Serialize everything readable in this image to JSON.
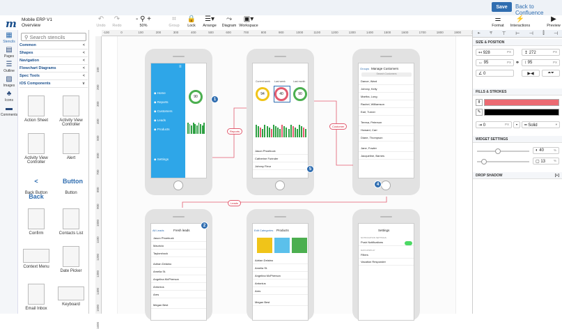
{
  "header": {
    "save_label": "Save",
    "back_label": "Back to Confluence",
    "app_title": "Mobile ERP V1",
    "page_name": "Overview",
    "logo": "m"
  },
  "toolbar": [
    {
      "name": "undo",
      "icon": "undo-icon",
      "glyph": "↶",
      "label": "Undo",
      "disabled": true
    },
    {
      "name": "redo",
      "icon": "redo-icon",
      "glyph": "↷",
      "label": "Redo",
      "disabled": true
    },
    {
      "name": "zoom",
      "icon": "zoom-icon",
      "glyph": "- ⚲ +",
      "label": "50%",
      "disabled": false
    },
    {
      "name": "group",
      "icon": "group-icon",
      "glyph": "⌗",
      "label": "Group",
      "disabled": true
    },
    {
      "name": "lock",
      "icon": "lock-icon",
      "glyph": "🔒",
      "label": "Lock",
      "disabled": false
    },
    {
      "name": "arrange",
      "icon": "arrange-icon",
      "glyph": "☰▾",
      "label": "Arrange",
      "disabled": false
    },
    {
      "name": "diagram",
      "icon": "diagram-icon",
      "glyph": "⤳",
      "label": "Diagram",
      "disabled": false
    },
    {
      "name": "workspace",
      "icon": "workspace-icon",
      "glyph": "▣▾",
      "label": "Workspace",
      "disabled": false
    }
  ],
  "right_toolbar": [
    {
      "name": "format",
      "icon": "format-icon",
      "glyph": "⚌",
      "label": "Format"
    },
    {
      "name": "interactions",
      "icon": "lightning-icon",
      "glyph": "⚡",
      "label": "Interactions"
    },
    {
      "name": "preview",
      "icon": "preview-icon",
      "glyph": "▶",
      "label": "Preview"
    }
  ],
  "leftnav": [
    {
      "name": "stencils",
      "icon": "stencils-icon",
      "glyph": "▦",
      "label": "Stencils",
      "active": true
    },
    {
      "name": "pages",
      "icon": "pages-icon",
      "glyph": "▤",
      "label": "Pages",
      "active": false
    },
    {
      "name": "outline",
      "icon": "outline-icon",
      "glyph": "☰",
      "label": "Outline",
      "active": false
    },
    {
      "name": "images",
      "icon": "images-icon",
      "glyph": "▨",
      "label": "Images",
      "active": false
    },
    {
      "name": "icons",
      "icon": "club-icon",
      "glyph": "♣",
      "label": "Icons",
      "active": false
    },
    {
      "name": "comments",
      "icon": "comments-icon",
      "glyph": "▬",
      "label": "Comments",
      "active": false
    }
  ],
  "stencil_search": "Search stencils",
  "categories": [
    {
      "label": "Common",
      "state": "<"
    },
    {
      "label": "Shapes",
      "state": "<"
    },
    {
      "label": "Navigation",
      "state": "<"
    },
    {
      "label": "Flowchart Diagrams",
      "state": "<"
    },
    {
      "label": "Spec Tools",
      "state": "<"
    },
    {
      "label": "iOS Components",
      "state": "∨"
    }
  ],
  "stencils": [
    {
      "label": "Action Sheet",
      "thumb": "normal"
    },
    {
      "label": "Activity View Controller",
      "thumb": "normal"
    },
    {
      "label": "Activity View Controller",
      "thumb": "normal"
    },
    {
      "label": "Alert",
      "thumb": "normal"
    },
    {
      "label": "Back Button",
      "thumb": "back",
      "text": "< Back"
    },
    {
      "label": "Button",
      "thumb": "button",
      "text": "Button"
    },
    {
      "label": "Confirm",
      "thumb": "normal"
    },
    {
      "label": "Contacts List",
      "thumb": "normal"
    },
    {
      "label": "Context Menu",
      "thumb": "wide"
    },
    {
      "label": "Date Picker",
      "thumb": "normal"
    },
    {
      "label": "Email Inbox",
      "thumb": "normal"
    },
    {
      "label": "Keyboard",
      "thumb": "wide"
    }
  ],
  "ruler_h": [
    "-100",
    "0",
    "100",
    "200",
    "300",
    "400",
    "500",
    "600",
    "700",
    "800",
    "900",
    "1000",
    "1100",
    "1200",
    "1300",
    "1400",
    "1500",
    "1600",
    "1700",
    "1800",
    "1900",
    "2000"
  ],
  "ruler_v": [
    "100",
    "200",
    "300",
    "400",
    "500",
    "600",
    "700",
    "800",
    "900",
    "1000",
    "1100",
    "1200",
    "1300",
    "1400",
    "1500",
    "1600"
  ],
  "right_panel": {
    "size_title": "SIZE & POSITION",
    "x": "928",
    "y": "272",
    "w": "95",
    "h": "95",
    "rotation": "0",
    "unit": "PX",
    "fills_title": "FILLS & STROKES",
    "fill_color": "#ec6a72",
    "stroke_color": "#000000",
    "stroke_width": "0",
    "stroke_style": "Solid",
    "widget_title": "WIDGET SETTINGS",
    "opacity": "40",
    "corner": "13",
    "pct": "%",
    "opacity_frac": 0.4,
    "corner_frac": 0.13,
    "shadow_title": "DROP SHADOW",
    "shadow_ctrl": "[+]"
  },
  "phones": {
    "p1": {
      "menu": [
        "Home",
        "Reports",
        "Customers",
        "Leads",
        "Products",
        "Settings"
      ],
      "badge": "1",
      "pct": "90"
    },
    "p2": {
      "left": "Current week",
      "mid": "Last week",
      "right": "Last month",
      "v1": "94",
      "v2": "40",
      "v3": "90",
      "rows": [
        "Jason Phoebuck",
        "Catherine Furinder",
        "Johnny Fleur"
      ],
      "badge": "5"
    },
    "p3": {
      "nav_left": "Groups",
      "nav_title": "Manage Customers",
      "search": "Search Customers",
      "rows": [
        "Dance, Ward",
        "Johnny, Kelly",
        "Martha, Long",
        "Rachel, Williamson",
        "Earl, Turner",
        "Teresa, Peterson",
        "Howard, Carr",
        "Diane, Thompson",
        "Jane, Fowler",
        "Jacqueline, Barnes"
      ],
      "badge": "4"
    },
    "p4": {
      "back": "All Leads",
      "title": "Fresh leads",
      "rows": [
        "Jason Phoebuck",
        "Mauricio",
        "Taylorshock",
        "Adrian Delaino",
        "Amelia St.",
        "Angelina McPherson",
        "Antonius",
        "Ares",
        "Megan Best"
      ],
      "badge": "2"
    },
    "p5": {
      "edit": "Edit Categories",
      "title": "Products",
      "rows": [
        "Adrian Delaino",
        "Amelia St.",
        "Angelina McPherson",
        "Antonius",
        "Ares",
        "Megan Best"
      ]
    },
    "p6": {
      "title": "Settings",
      "section": "NOTIFICATION SETTINGS",
      "push": "Push Notifications",
      "section2": "DATA DISPLAY",
      "filters": "Filters",
      "vacation": "Vacation Responder"
    }
  },
  "connectors": [
    "Reports",
    "Customer",
    "Leads"
  ],
  "colors": {
    "accent": "#2f6db0",
    "sidebar_blue": "#2ea6e8",
    "bar_green": "#2ea043",
    "bar_red": "#e25b6f",
    "ring_yellow": "#f0c419",
    "ring_red": "#e25b6f",
    "ring_green": "#4caf50",
    "toggle_green": "#4cd964"
  }
}
